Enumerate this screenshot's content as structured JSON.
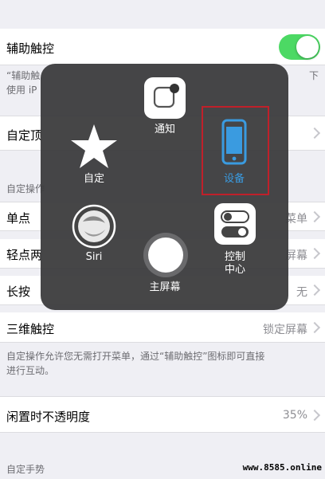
{
  "rows": {
    "assistive_touch": {
      "label": "辅助触控"
    },
    "custom_top": {
      "label": "自定顶"
    },
    "single_tap": {
      "label": "单点",
      "value": "菜单"
    },
    "double_tap": {
      "label": "轻点两",
      "value": "屏幕"
    },
    "long_press": {
      "label": "长按",
      "value": "无"
    },
    "force_touch": {
      "label": "三维触控",
      "value": "锁定屏幕"
    },
    "idle_opacity": {
      "label": "闲置时不透明度",
      "value": "35%"
    }
  },
  "footnote_top": "“辅助触",
  "footnote_top_line2": "使用 iP",
  "footnote_top_right": "下",
  "section_custom_ops": "自定操作",
  "footnote_actions_line1": "自定操作允许您无需打开菜单，通过“辅助触控”图标即可直接",
  "footnote_actions_line2": "进行互动。",
  "section_custom_gestures": "自定手势",
  "menu": {
    "notification": "通知",
    "custom": "自定",
    "device": "设备",
    "siri": "Siri",
    "home": "主屏幕",
    "control_center_1": "控制",
    "control_center_2": "中心"
  },
  "colors": {
    "toggle_on": "#4cd964",
    "device_blue": "#3a9be0",
    "highlight_red": "#c0202a"
  },
  "watermark": "www.8585.online"
}
